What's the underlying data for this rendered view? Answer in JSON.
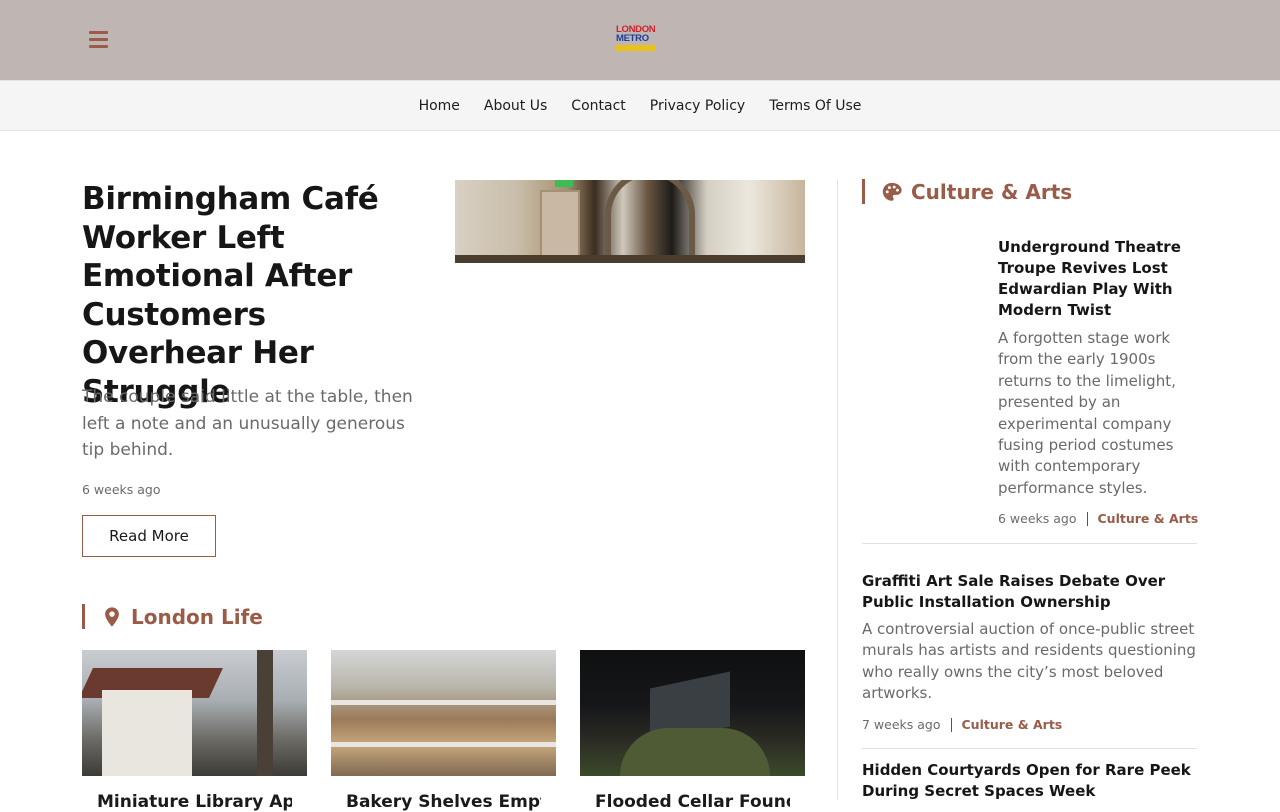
{
  "header": {
    "menu_icon": "hamburger-icon",
    "logo": {
      "line1": "LONDON",
      "line2": "METRO"
    }
  },
  "nav": {
    "items": [
      "Home",
      "About Us",
      "Contact",
      "Privacy Policy",
      "Terms Of Use"
    ]
  },
  "hero": {
    "title": "Birmingham Café Worker Left Emotional After Customers Overhear Her Struggle",
    "excerpt": "The couple said little at the table, then left a note and an unusually generous tip behind.",
    "time": "6 weeks ago",
    "read_more": "Read More"
  },
  "london_life": {
    "icon": "map-pin-icon",
    "title": "London Life",
    "items": [
      {
        "title": "Miniature Library Appears"
      },
      {
        "title": "Bakery Shelves Emptied"
      },
      {
        "title": "Flooded Cellar Found"
      }
    ]
  },
  "culture_arts": {
    "icon": "palette-icon",
    "title": "Culture & Arts",
    "cards": [
      {
        "title": "Underground Theatre Troupe Revives Lost Edwardian Play With Modern Twist",
        "excerpt": "A forgotten stage work from the early 1900s returns to the limelight, presented by an experimental company fusing period costumes with contemporary performance styles.",
        "time": "6 weeks ago",
        "category": "Culture & Arts"
      },
      {
        "title": "Graffiti Art Sale Raises Debate Over Public Installation Ownership",
        "excerpt": "A controversial auction of once-public street murals has artists and residents questioning who really owns the city’s most beloved artworks.",
        "time": "7 weeks ago",
        "category": "Culture & Arts"
      },
      {
        "title": "Hidden Courtyards Open for Rare Peek During Secret Spaces Week"
      }
    ]
  },
  "colors": {
    "accent": "#9a5b48",
    "header_bg": "#bfb6b4",
    "nav_bg": "#f5f5f5"
  }
}
